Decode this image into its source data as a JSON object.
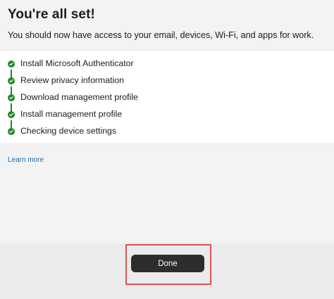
{
  "header": {
    "title": "You're all set!",
    "subtitle": "You should now have access to your email, devices, Wi-Fi, and apps for work."
  },
  "steps": [
    {
      "label": "Install Microsoft Authenticator",
      "status": "complete"
    },
    {
      "label": "Review privacy information",
      "status": "complete"
    },
    {
      "label": "Download management profile",
      "status": "complete"
    },
    {
      "label": "Install management profile",
      "status": "complete"
    },
    {
      "label": "Checking device settings",
      "status": "complete"
    }
  ],
  "links": {
    "learn_more": "Learn more"
  },
  "footer": {
    "done_label": "Done"
  },
  "colors": {
    "check_green": "#1e8a2c",
    "link_blue": "#0f6cbd",
    "button_dark": "#2d2d2d",
    "highlight_red": "#d9534f"
  }
}
